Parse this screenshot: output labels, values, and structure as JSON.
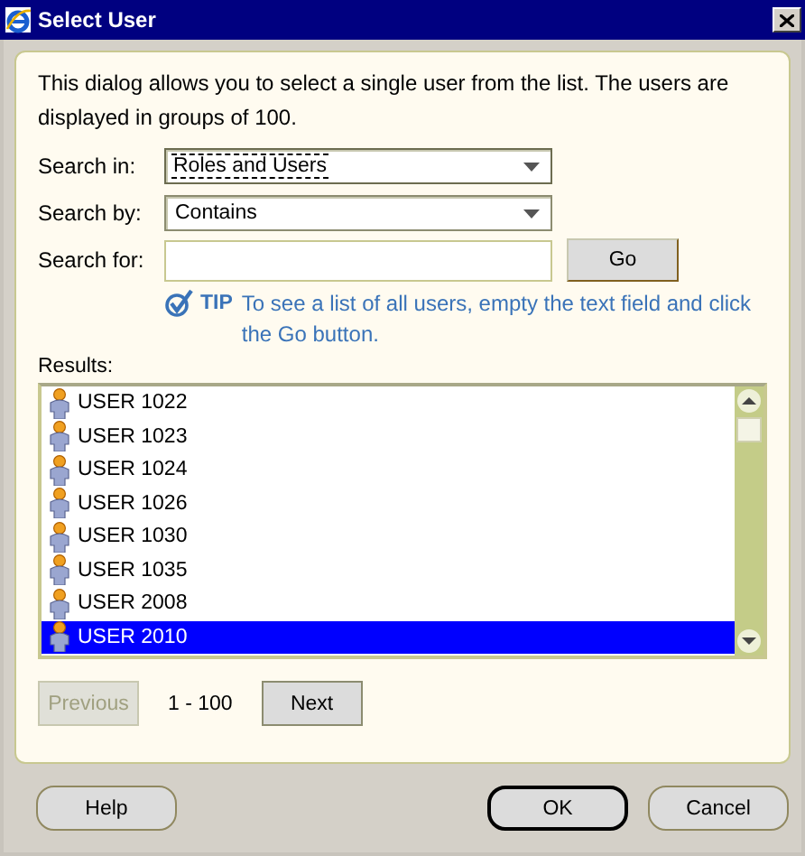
{
  "window": {
    "title": "Select User"
  },
  "intro": "This dialog allows you to select a single user from the list. The users are displayed in groups of 100.",
  "fields": [
    {
      "kind": "select",
      "label": "Search in:",
      "value": "Roles and Users",
      "focused": true
    },
    {
      "kind": "select",
      "label": "Search by:",
      "value": "Contains",
      "focused": false
    },
    {
      "kind": "text",
      "label": "Search for:",
      "button": "Go"
    }
  ],
  "tip": {
    "label": "TIP",
    "text": "To see a list of all users, empty the text field and click the Go button."
  },
  "results": {
    "label": "Results:",
    "items": [
      {
        "name": "USER 1022",
        "selected": false
      },
      {
        "name": "USER 1023",
        "selected": false
      },
      {
        "name": "USER 1024",
        "selected": false
      },
      {
        "name": "USER 1026",
        "selected": false
      },
      {
        "name": "USER 1030",
        "selected": false
      },
      {
        "name": "USER 1035",
        "selected": false
      },
      {
        "name": "USER 2008",
        "selected": false
      },
      {
        "name": "USER 2010",
        "selected": true
      }
    ]
  },
  "pager": {
    "previous": {
      "label": "Previous",
      "disabled": true
    },
    "range": "1 - 100",
    "next": {
      "label": "Next",
      "disabled": false
    }
  },
  "buttons": [
    {
      "label": "Help",
      "default": false
    },
    {
      "label": "OK",
      "default": true
    },
    {
      "label": "Cancel",
      "default": false
    }
  ]
}
